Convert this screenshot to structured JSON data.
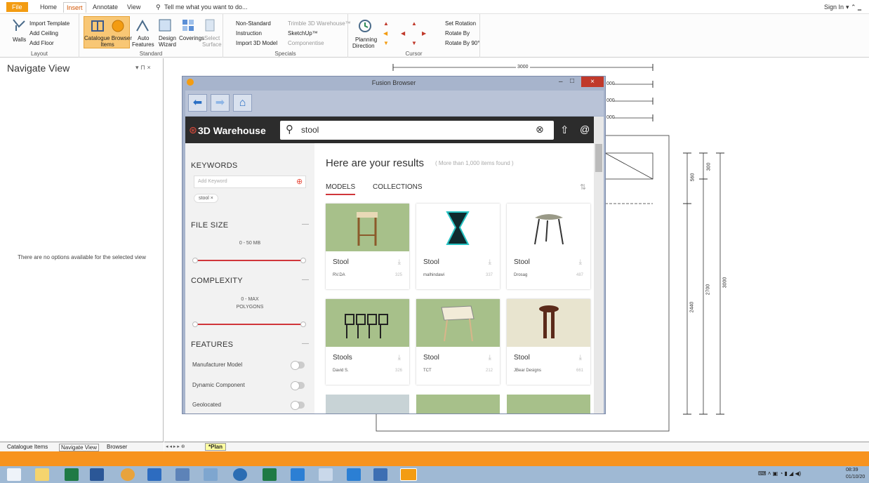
{
  "ribbon": {
    "tabs": {
      "file": "File",
      "home": "Home",
      "insert": "Insert",
      "annotate": "Annotate",
      "view": "View",
      "tell": "Tell me what you want to do..."
    },
    "sign_in": "Sign In",
    "walls": "Walls",
    "import_template": "Import Template",
    "add_ceiling": "Add Ceiling",
    "add_floor": "Add Floor",
    "layout_group": "Layout",
    "catalogue_browser": "Catalogue Browser",
    "catalogue_items": "Items",
    "auto": "Auto",
    "auto_features": "Features",
    "design": "Design",
    "design_wizard": "Wizard",
    "coverings": "Coverings",
    "select_surface_1": "Select",
    "select_surface_2": "Surface",
    "standard_group": "Standard",
    "non_standard": "Non-Standard",
    "trimble": "Trimble 3D Warehouse™",
    "instruction": "Instruction",
    "sketchup": "SketchUp™",
    "import_3d": "Import 3D Model",
    "componentise": "Componentise",
    "specials_group": "Specials",
    "planning": "Planning",
    "planning_direction": "Direction",
    "set_rotation": "Set Rotation",
    "rotate_by": "Rotate By",
    "rotate_by_90": "Rotate By 90°",
    "cursor_group": "Cursor"
  },
  "left_panel": {
    "title": "Navigate View",
    "controls": "▾ ⊓ ×",
    "no_options": "There are no options available for the selected view",
    "tabs": {
      "catalogue": "Catalogue Items",
      "navigate": "Navigate View",
      "browser": "Browser"
    }
  },
  "plan_tab": "*Plan",
  "drawing": {
    "dim_top": "3000",
    "dim_560": "560",
    "dim_300": "300",
    "dim_2440": "2440",
    "dim_2700": "2700",
    "dim_3000v": "3000",
    "dim_000a": "000",
    "dim_000b": "000",
    "dim_000c": "000"
  },
  "browser": {
    "title": "Fusion Browser",
    "close": "×",
    "minimize": "–",
    "maximize": "□",
    "logo": "3D Warehouse",
    "search_value": "stool",
    "keywords_heading": "KEYWORDS",
    "add_keyword_placeholder": "Add Keyword",
    "keyword_chip": "stool ×",
    "file_size_heading": "FILE SIZE",
    "file_size_range": "0 - 50 MB",
    "complexity_heading": "COMPLEXITY",
    "complexity_range_1": "0 - MAX",
    "complexity_range_2": "POLYGONS",
    "features_heading": "FEATURES",
    "features": [
      "Manufacturer Model",
      "Dynamic Component",
      "Geolocated"
    ],
    "results_heading": "Here are your results",
    "results_sub": "( More than 1,000 items found )",
    "tab_models": "MODELS",
    "tab_collections": "COLLECTIONS",
    "cards": [
      {
        "title": "Stool",
        "author": "RV.DA",
        "count": "325"
      },
      {
        "title": "Stool",
        "author": "malhindawi",
        "count": "337"
      },
      {
        "title": "Stool",
        "author": "Drosag",
        "count": "487"
      },
      {
        "title": "Stools",
        "author": "David S.",
        "count": "326"
      },
      {
        "title": "Stool",
        "author": "TCT",
        "count": "212"
      },
      {
        "title": "Stool",
        "author": "JBear Designs",
        "count": "661"
      }
    ]
  },
  "taskbar": {
    "time": "08:39",
    "date": "01/10/20"
  }
}
